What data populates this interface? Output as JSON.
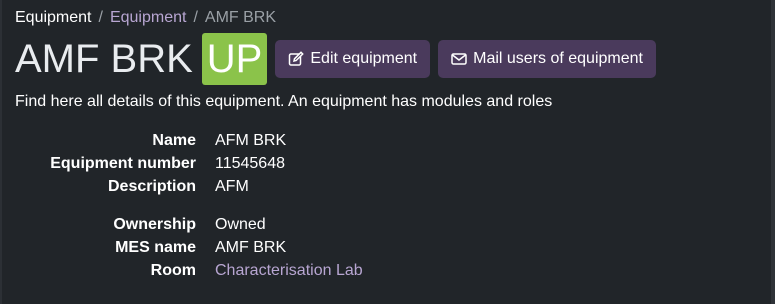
{
  "breadcrumb": {
    "root": "Equipment",
    "parent": "Equipment",
    "current": "AMF BRK",
    "separator": "/"
  },
  "header": {
    "title": "AMF BRK",
    "status": "UP",
    "edit_label": "Edit equipment",
    "mail_label": "Mail users of equipment"
  },
  "description": "Find here all details of this equipment. An equipment has modules and roles",
  "details": {
    "group1": [
      {
        "label": "Name",
        "value": "AFM BRK"
      },
      {
        "label": "Equipment number",
        "value": "11545648"
      },
      {
        "label": "Description",
        "value": "AFM"
      }
    ],
    "group2": [
      {
        "label": "Ownership",
        "value": "Owned"
      },
      {
        "label": "MES name",
        "value": "AMF BRK"
      },
      {
        "label": "Room",
        "value": "Characterisation Lab"
      }
    ]
  },
  "icons": {
    "edit": "edit-icon",
    "mail": "envelope-icon"
  },
  "colors": {
    "background": "#212529",
    "status_badge": "#8bc34a",
    "button": "#4a3a5c",
    "link": "#b8a6d2"
  }
}
